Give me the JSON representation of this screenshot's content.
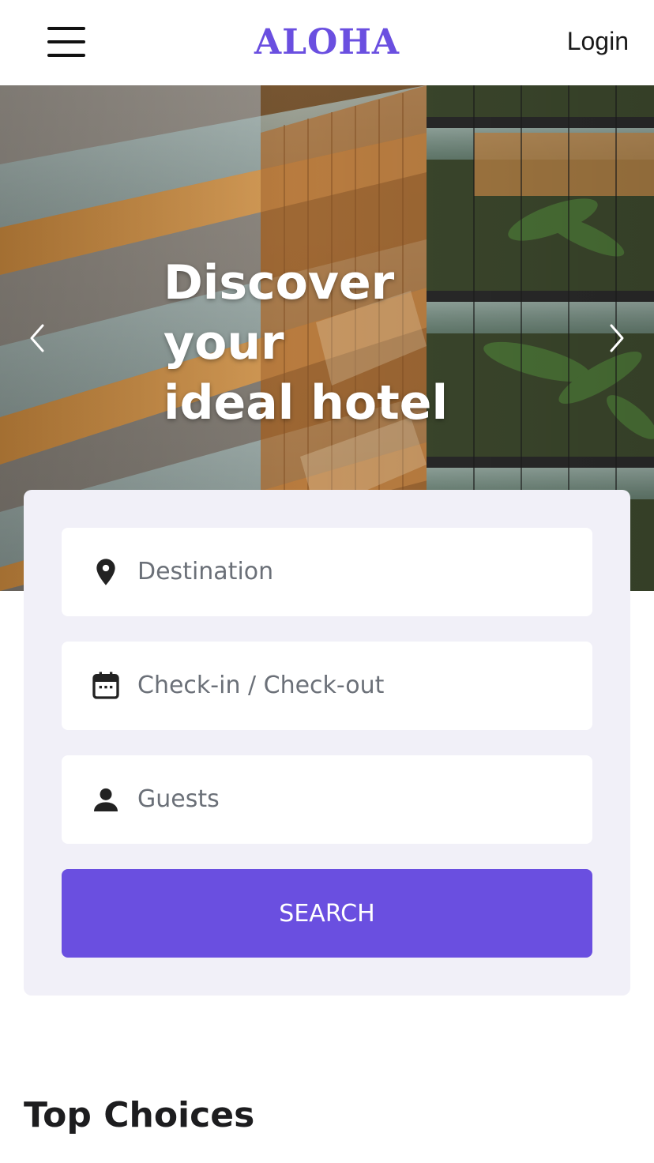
{
  "header": {
    "logo": "ALOHA",
    "login_label": "Login",
    "menu_icon": "hamburger-menu-icon"
  },
  "hero": {
    "title": "Discover\nyour\nideal hotel",
    "prev_icon": "chevron-left-icon",
    "next_icon": "chevron-right-icon"
  },
  "search": {
    "destination_placeholder": "Destination",
    "dates_placeholder": "Check-in / Check-out",
    "guests_placeholder": "Guests",
    "destination_icon": "location-pin-icon",
    "dates_icon": "calendar-icon",
    "guests_icon": "person-icon",
    "button_label": "SEARCH"
  },
  "sections": {
    "top_choices_title": "Top Choices"
  },
  "colors": {
    "accent": "#6a4fe0",
    "panel_bg": "#f1f0f8",
    "placeholder_text": "#6b7078"
  }
}
